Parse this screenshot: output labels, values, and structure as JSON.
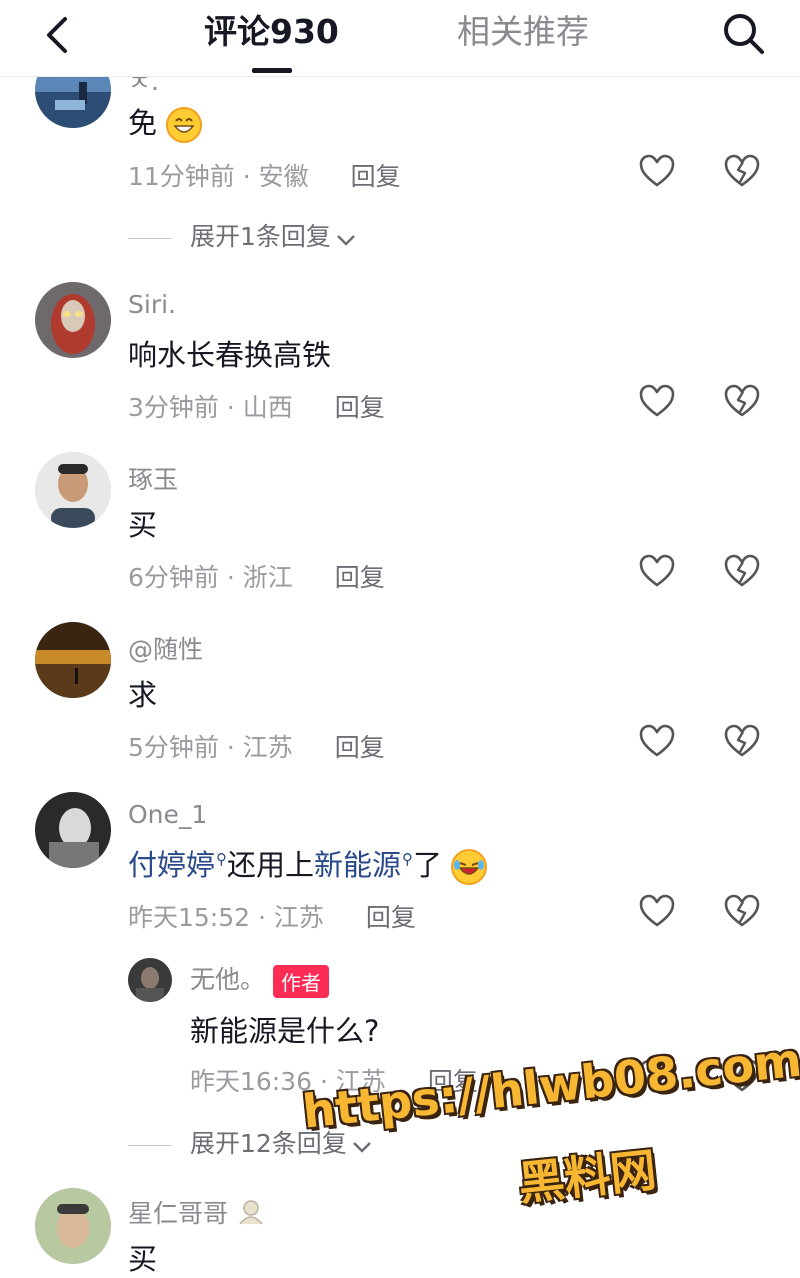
{
  "header": {
    "tab_comments": "评论930",
    "tab_related": "相关推荐",
    "back_icon": "chevron-left-icon",
    "search_icon": "search-icon"
  },
  "comments": [
    {
      "author": "ㅊ.",
      "text": "免",
      "emoji": "grinning-emoji",
      "time": "11分钟前",
      "location": "安徽",
      "reply_label": "回复",
      "expand_label": "展开1条回复"
    },
    {
      "author": "Siri.",
      "text": "响水长春换高铁",
      "time": "3分钟前",
      "location": "山西",
      "reply_label": "回复"
    },
    {
      "author": "琢玉",
      "text": "买",
      "time": "6分钟前",
      "location": "浙江",
      "reply_label": "回复"
    },
    {
      "author": "@随性",
      "text": "求",
      "time": "5分钟前",
      "location": "江苏",
      "reply_label": "回复"
    },
    {
      "author": "One_1",
      "link1": "付婷婷",
      "middle": "还用上",
      "link2": "新能源",
      "tail": "了",
      "emoji": "laughing-tears-emoji",
      "time": "昨天15:52",
      "location": "江苏",
      "reply_label": "回复",
      "reply": {
        "author": "无他。",
        "badge": "作者",
        "text": "新能源是什么?",
        "time": "昨天16:36",
        "location": "江苏",
        "reply_label": "回复"
      },
      "expand_label": "展开12条回复"
    },
    {
      "author": "星仁哥哥",
      "text": "买"
    }
  ],
  "watermark": {
    "url": "https://hlwb08.com",
    "name": "黑料网"
  },
  "colors": {
    "text": "#161823",
    "meta": "#9a9ba0",
    "link": "#2b4a8a",
    "badge": "#fe2c55",
    "watermark": "#f7b733"
  }
}
